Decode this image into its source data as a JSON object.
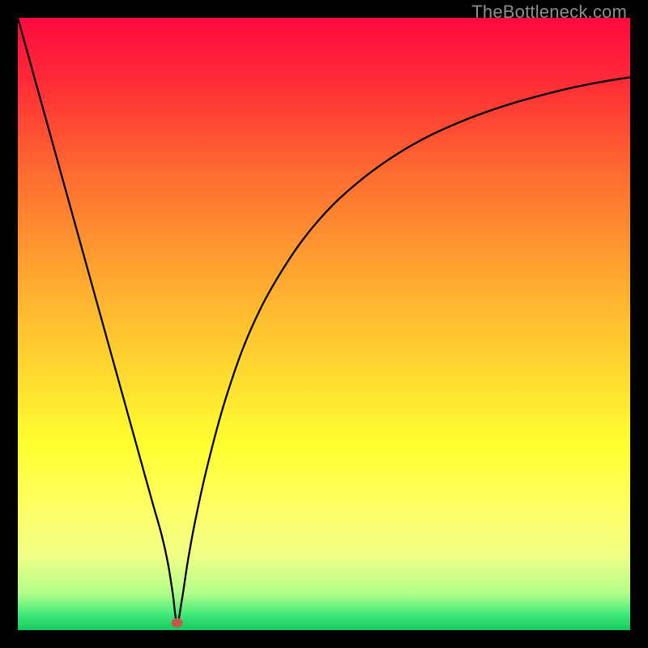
{
  "watermark": "TheBottleneck.com",
  "chart_data": {
    "type": "line",
    "title": "",
    "xlabel": "",
    "ylabel": "",
    "xlim": [
      0,
      100
    ],
    "ylim": [
      0,
      100
    ],
    "background_gradient": {
      "stops": [
        {
          "offset": 0.0,
          "color": "#ff0a3f"
        },
        {
          "offset": 0.1,
          "color": "#ff2a37"
        },
        {
          "offset": 0.25,
          "color": "#ff6a30"
        },
        {
          "offset": 0.4,
          "color": "#ffa030"
        },
        {
          "offset": 0.55,
          "color": "#ffd030"
        },
        {
          "offset": 0.7,
          "color": "#ffff30"
        },
        {
          "offset": 0.8,
          "color": "#ffff66"
        },
        {
          "offset": 0.88,
          "color": "#efff85"
        },
        {
          "offset": 0.94,
          "color": "#b0ff8a"
        },
        {
          "offset": 0.975,
          "color": "#40e879"
        },
        {
          "offset": 1.0,
          "color": "#16c95f"
        }
      ]
    },
    "marker": {
      "x": 26,
      "y": 1.2,
      "color": "#c25a4a",
      "rx": 7,
      "ry": 6
    },
    "series": [
      {
        "name": "bottleneck-curve",
        "color": "#000000",
        "stroke_width": 2.3,
        "x": [
          0,
          2,
          4,
          6,
          8,
          10,
          12,
          14,
          16,
          18,
          20,
          22,
          23.5,
          24.5,
          25.3,
          26,
          26.8,
          27.8,
          29,
          31,
          34,
          38,
          43,
          49,
          56,
          64,
          72,
          80,
          88,
          94,
          100
        ],
        "values": [
          100,
          92.8,
          85.6,
          78.4,
          71.2,
          64.0,
          56.8,
          49.6,
          42.4,
          35.2,
          28.0,
          20.8,
          15.5,
          11.0,
          6.0,
          1.2,
          5.0,
          11.5,
          18.0,
          27.0,
          38.0,
          49.0,
          58.5,
          66.8,
          73.5,
          79.0,
          82.9,
          85.8,
          88.0,
          89.3,
          90.3
        ]
      }
    ]
  }
}
